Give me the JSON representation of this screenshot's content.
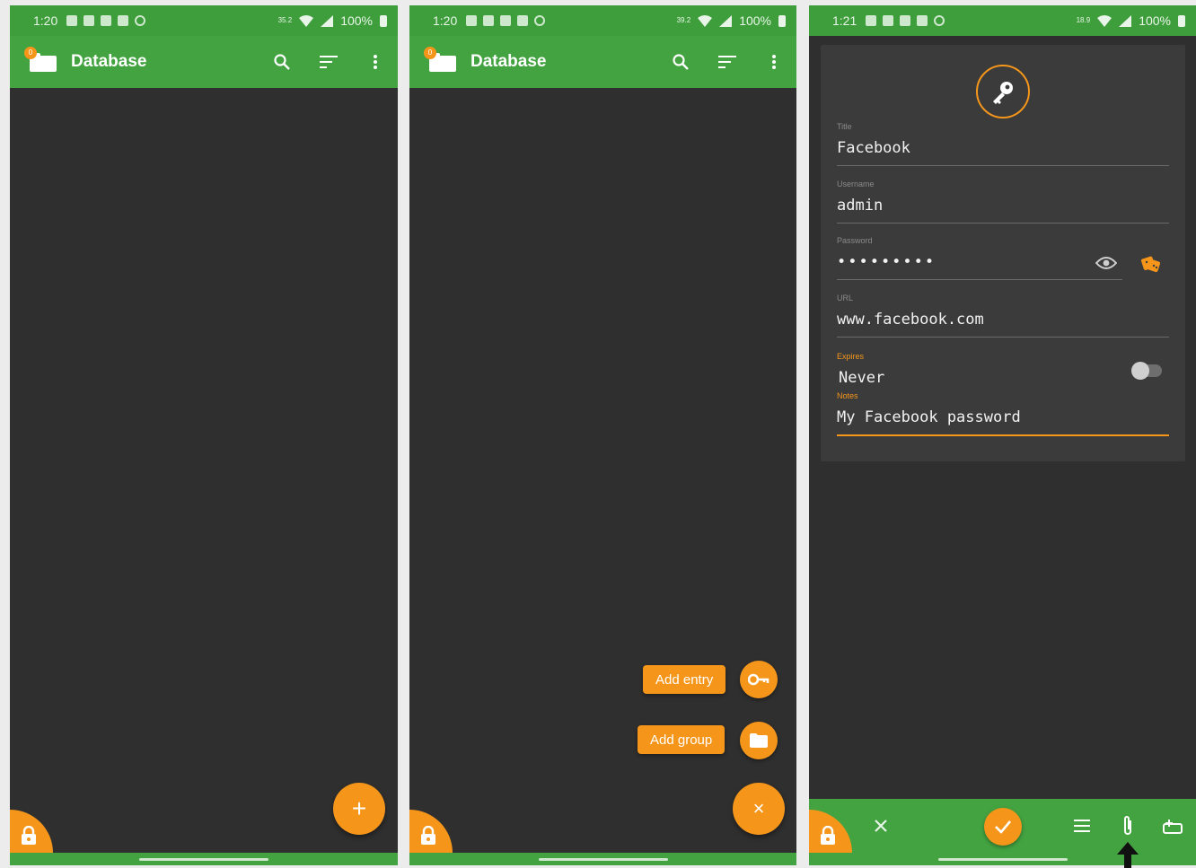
{
  "colors": {
    "green_appbar": "#43a341",
    "green_status": "#3f9e3c",
    "orange_accent": "#f5961b",
    "background_dark": "#2f2f2f",
    "card": "#3b3b3b"
  },
  "screen1": {
    "status": {
      "time": "1:20",
      "speed": "35.2",
      "battery": "100%"
    },
    "appbar": {
      "badge": "0",
      "title": "Database"
    },
    "icons": [
      "folder-icon",
      "search-icon",
      "sort-icon",
      "more-vert-icon",
      "plus-icon",
      "lock-icon"
    ],
    "fab_label": "+"
  },
  "screen2": {
    "status": {
      "time": "1:20",
      "speed": "39.2",
      "battery": "100%"
    },
    "appbar": {
      "badge": "0",
      "title": "Database"
    },
    "menu": {
      "add_entry": "Add entry",
      "add_group": "Add group"
    },
    "fab_label": "×",
    "icons": [
      "key-icon",
      "folder-icon",
      "close-icon",
      "lock-icon"
    ]
  },
  "screen3": {
    "status": {
      "time": "1:21",
      "speed": "18.9",
      "battery": "100%"
    },
    "form": {
      "title_label": "Title",
      "title_value": "Facebook",
      "username_label": "Username",
      "username_value": "admin",
      "password_label": "Password",
      "password_value": "•••••••••",
      "url_label": "URL",
      "url_value": "www.facebook.com",
      "expires_label": "Expires",
      "expires_value": "Never",
      "expires_enabled": false,
      "notes_label": "Notes",
      "notes_value": "My Facebook password"
    },
    "bottombar": {
      "icons": [
        "lock-icon",
        "close-icon",
        "check-icon",
        "menu-icon",
        "attachment-icon",
        "add-field-icon"
      ]
    }
  }
}
